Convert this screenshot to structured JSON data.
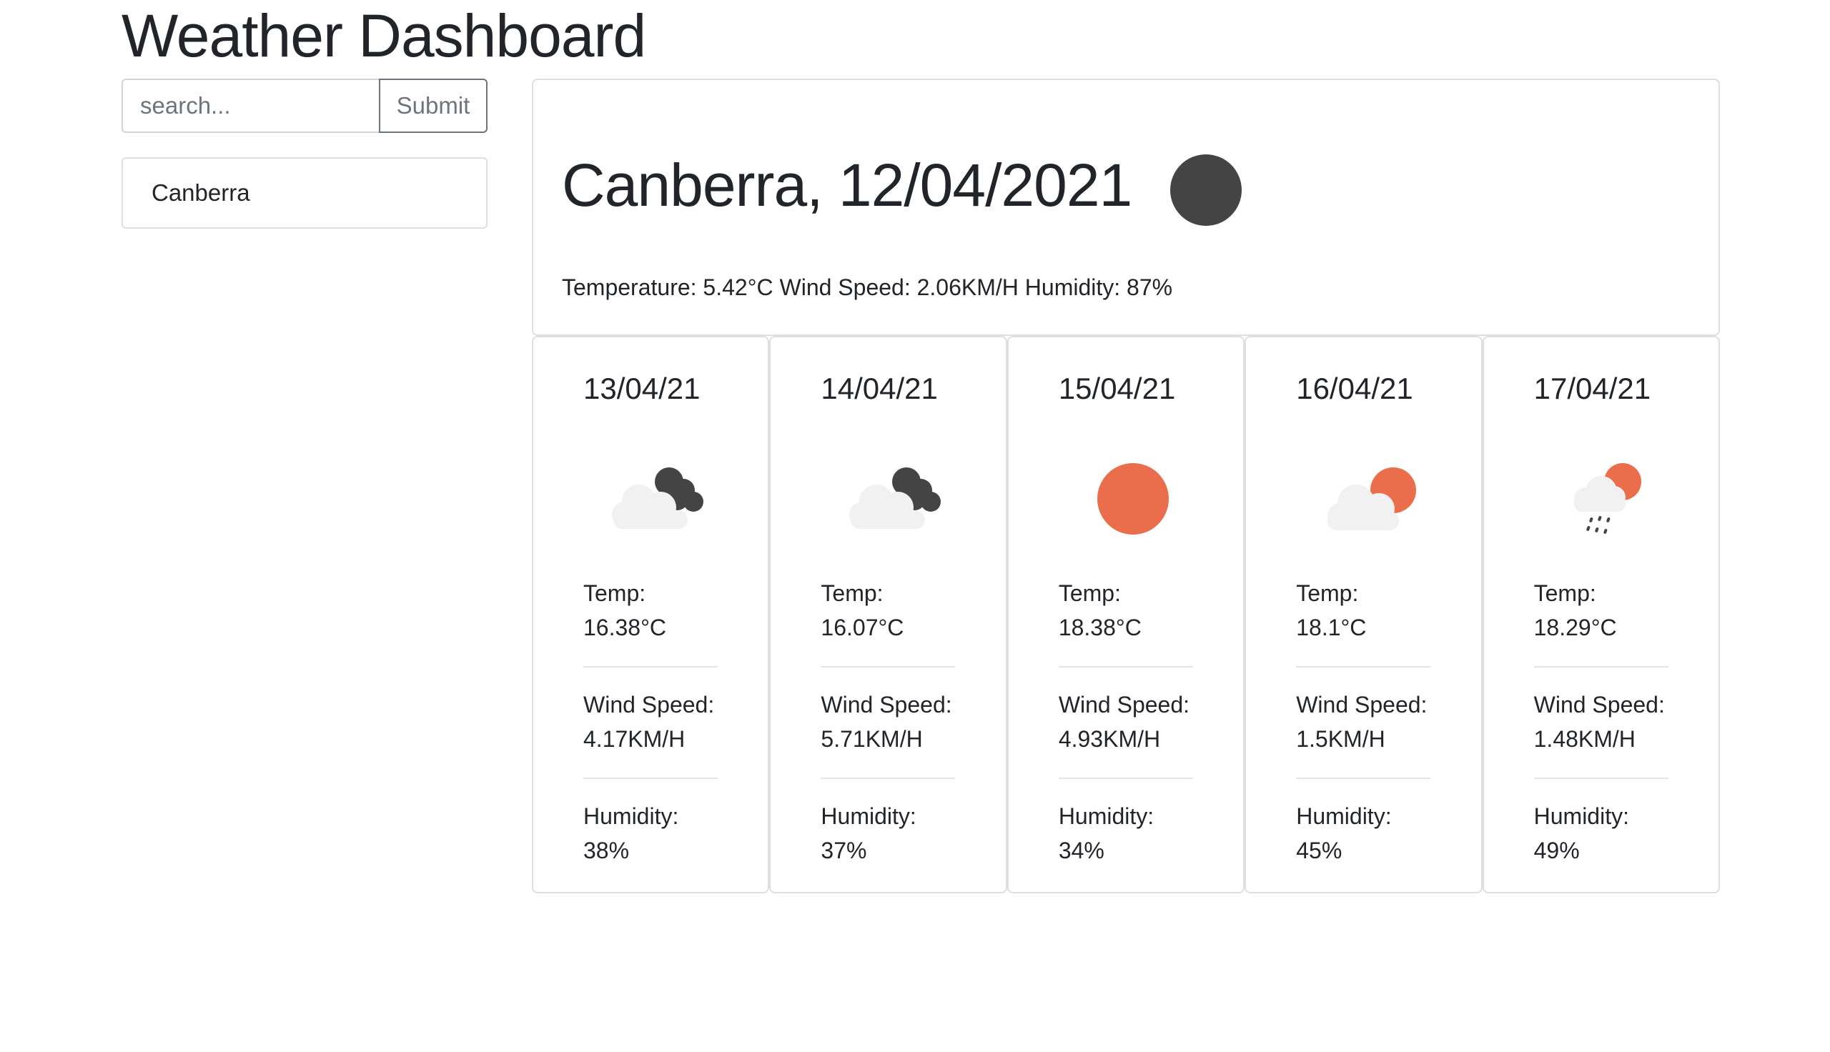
{
  "page": {
    "title": "Weather Dashboard"
  },
  "search": {
    "placeholder": "search...",
    "value": "",
    "submit_label": "Submit"
  },
  "history": [
    "Canberra"
  ],
  "current": {
    "title": "Canberra, 12/04/2021",
    "icon": "dark-cloud-icon",
    "stats": "Temperature: 5.42°C Wind Speed: 2.06KM/H Humidity: 87%"
  },
  "forecast": [
    {
      "date": "13/04/21",
      "icon": "broken-clouds-icon",
      "temp_label": "Temp:",
      "temp": "16.38°C",
      "wind_label": "Wind Speed:",
      "wind": "4.17KM/H",
      "humidity_label": "Humidity:",
      "humidity": "38%"
    },
    {
      "date": "14/04/21",
      "icon": "broken-clouds-icon",
      "temp_label": "Temp:",
      "temp": "16.07°C",
      "wind_label": "Wind Speed:",
      "wind": "5.71KM/H",
      "humidity_label": "Humidity:",
      "humidity": "37%"
    },
    {
      "date": "15/04/21",
      "icon": "clear-sun-icon",
      "temp_label": "Temp:",
      "temp": "18.38°C",
      "wind_label": "Wind Speed:",
      "wind": "4.93KM/H",
      "humidity_label": "Humidity:",
      "humidity": "34%"
    },
    {
      "date": "16/04/21",
      "icon": "partly-cloudy-icon",
      "temp_label": "Temp:",
      "temp": "18.1°C",
      "wind_label": "Wind Speed:",
      "wind": "1.5KM/H",
      "humidity_label": "Humidity:",
      "humidity": "45%"
    },
    {
      "date": "17/04/21",
      "icon": "sun-shower-icon",
      "temp_label": "Temp:",
      "temp": "18.29°C",
      "wind_label": "Wind Speed:",
      "wind": "1.48KM/H",
      "humidity_label": "Humidity:",
      "humidity": "49%"
    }
  ],
  "colors": {
    "sun": "#ea6e4b",
    "dark_cloud": "#444444",
    "light_cloud": "#f1f1f1",
    "border": "#dfdfdf",
    "text": "#212529"
  }
}
